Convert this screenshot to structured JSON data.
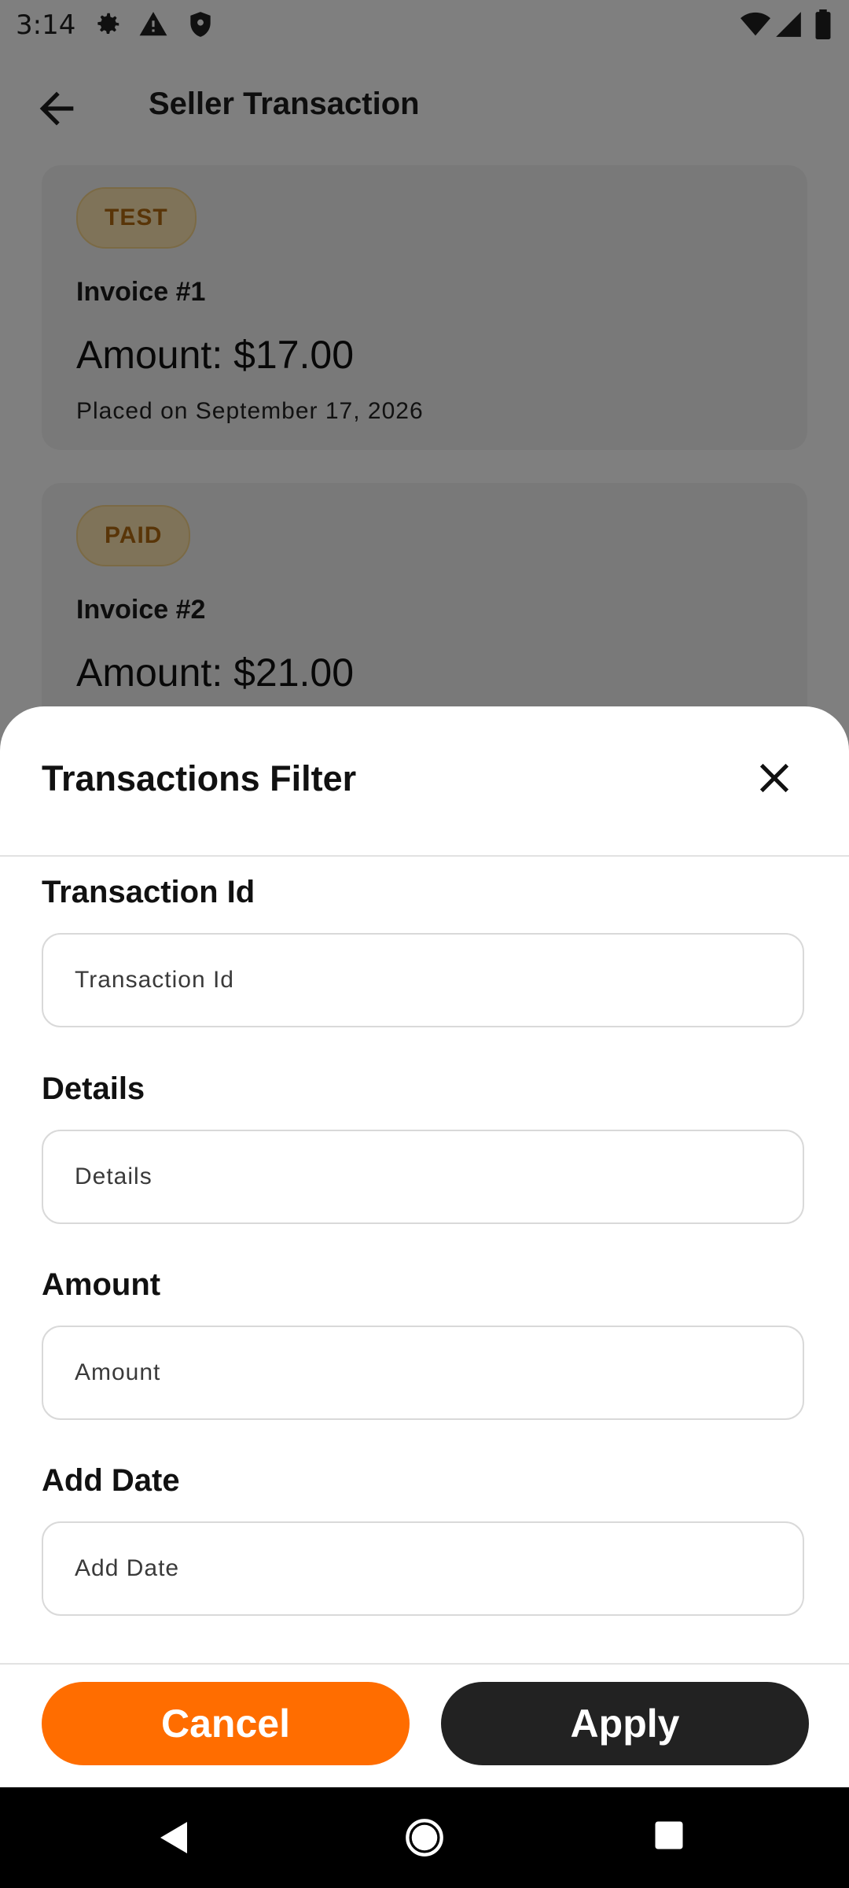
{
  "status_bar": {
    "time": "3:14",
    "left_icons": [
      "gear-icon",
      "warning-icon",
      "shield-icon"
    ],
    "right_icons": [
      "wifi-icon",
      "signal-icon",
      "battery-icon"
    ]
  },
  "app_bar": {
    "title": "Seller Transaction",
    "back_icon": "arrow-left-icon"
  },
  "transactions": [
    {
      "status": "TEST",
      "invoice": "Invoice #1",
      "amount": "Amount: $17.00",
      "placed": "Placed on September 17, 2026"
    },
    {
      "status": "PAID",
      "invoice": "Invoice #2",
      "amount": "Amount: $21.00"
    }
  ],
  "filter_sheet": {
    "title": "Transactions Filter",
    "fields": [
      {
        "label": "Transaction Id",
        "placeholder": "Transaction Id"
      },
      {
        "label": "Details",
        "placeholder": "Details"
      },
      {
        "label": "Amount",
        "placeholder": "Amount"
      },
      {
        "label": "Add Date",
        "placeholder": "Add Date"
      }
    ],
    "cancel_label": "Cancel",
    "apply_label": "Apply"
  },
  "colors": {
    "accent": "#ff6d00",
    "apply_button": "#222222",
    "badge_bg": "#ffe7b3",
    "badge_text": "#b36b10"
  },
  "nav_bar": {
    "icons": [
      "nav-back-icon",
      "nav-home-icon",
      "nav-recents-icon"
    ]
  }
}
